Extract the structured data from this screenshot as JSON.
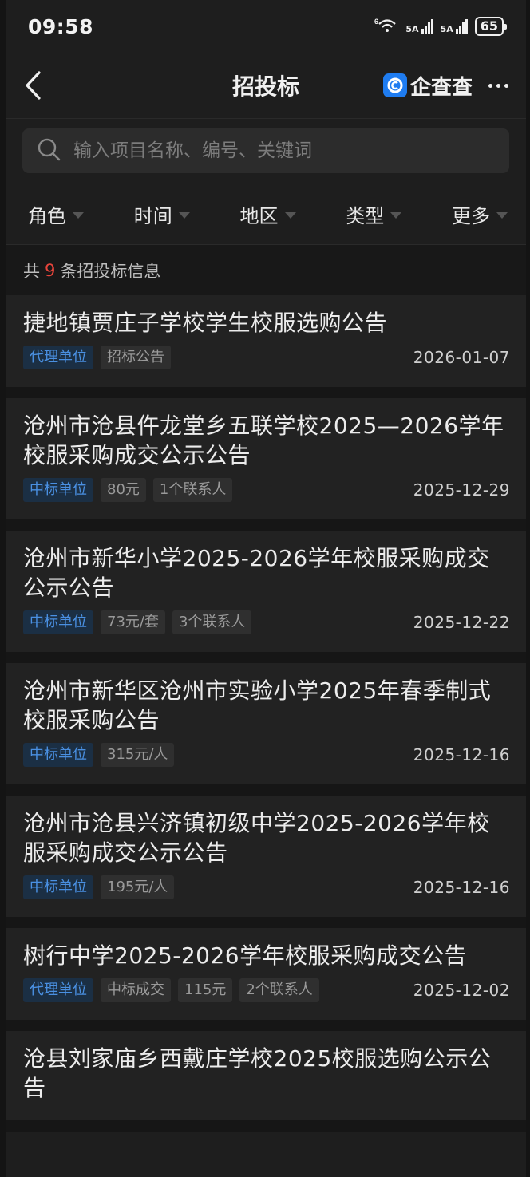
{
  "status": {
    "time": "09:58",
    "battery": "65",
    "sig1": "5A",
    "sig2": "5A",
    "wifi": "6"
  },
  "nav": {
    "title": "招投标",
    "brand": "企查查"
  },
  "search": {
    "placeholder": "输入项目名称、编号、关键词"
  },
  "filters": [
    "角色",
    "时间",
    "地区",
    "类型",
    "更多"
  ],
  "count": {
    "prefix": "共",
    "num": "9",
    "suffix": "条招投标信息"
  },
  "items": [
    {
      "title": "捷地镇贾庄子学校学生校服选购公告",
      "tags": [
        "代理单位",
        "招标公告"
      ],
      "date": "2026-01-07"
    },
    {
      "title": "沧州市沧县仵龙堂乡五联学校2025—2026学年校服采购成交公示公告",
      "tags": [
        "中标单位",
        "80元",
        "1个联系人"
      ],
      "date": "2025-12-29"
    },
    {
      "title": "沧州市新华小学2025-2026学年校服采购成交公示公告",
      "tags": [
        "中标单位",
        "73元/套",
        "3个联系人"
      ],
      "date": "2025-12-22"
    },
    {
      "title": "沧州市新华区沧州市实验小学2025年春季制式校服采购公告",
      "tags": [
        "中标单位",
        "315元/人"
      ],
      "date": "2025-12-16"
    },
    {
      "title": "沧州市沧县兴济镇初级中学2025-2026学年校服采购成交公示公告",
      "tags": [
        "中标单位",
        "195元/人"
      ],
      "date": "2025-12-16"
    },
    {
      "title": "树行中学2025-2026学年校服采购成交公告",
      "tags": [
        "代理单位",
        "中标成交",
        "115元",
        "2个联系人"
      ],
      "date": "2025-12-02"
    },
    {
      "title": "沧县刘家庙乡西戴庄学校2025校服选购公示公告",
      "tags": [],
      "date": ""
    }
  ]
}
